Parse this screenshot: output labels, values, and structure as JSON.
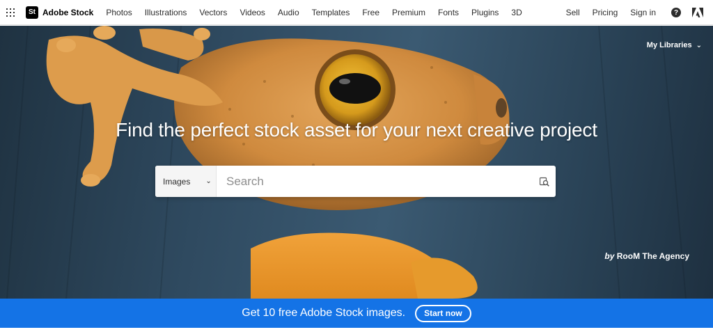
{
  "nav": {
    "brand_logo": "St",
    "brand_name": "Adobe Stock",
    "links": [
      "Photos",
      "Illustrations",
      "Vectors",
      "Videos",
      "Audio",
      "Templates",
      "Free",
      "Premium",
      "Fonts",
      "Plugins",
      "3D"
    ],
    "right": {
      "sell": "Sell",
      "pricing": "Pricing",
      "signin": "Sign in",
      "help": "?"
    }
  },
  "hero": {
    "libraries_label": "My Libraries",
    "headline": "Find the perfect stock asset for your next creative project",
    "asset_type": "Images",
    "search_placeholder": "Search",
    "credit_by": "by",
    "credit_name": "RooM The Agency"
  },
  "promo": {
    "text": "Get 10 free Adobe Stock images.",
    "button": "Start now"
  },
  "colors": {
    "accent": "#1473e6",
    "frog": "#d89445",
    "background": "#2f4a60"
  },
  "icons": [
    "app-switcher-icon",
    "help-icon",
    "adobe-logo-icon",
    "chevron-down-icon",
    "visual-search-icon"
  ]
}
